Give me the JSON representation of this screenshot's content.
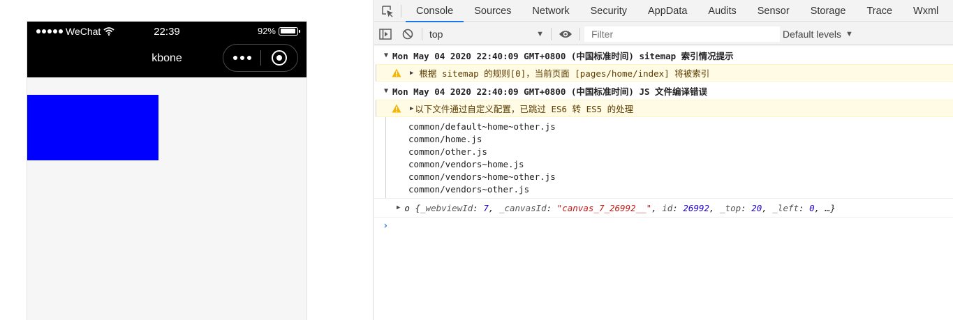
{
  "simulator": {
    "status_bar": {
      "carrier": "WeChat",
      "time": "22:39",
      "battery_percent": "92%",
      "battery_level": 0.92
    },
    "nav_bar": {
      "title": "kbone"
    },
    "content": {
      "box_color": "#0000ff"
    }
  },
  "devtools": {
    "tabs": [
      {
        "label": "Console",
        "active": true
      },
      {
        "label": "Sources"
      },
      {
        "label": "Network"
      },
      {
        "label": "Security"
      },
      {
        "label": "AppData"
      },
      {
        "label": "Audits"
      },
      {
        "label": "Sensor"
      },
      {
        "label": "Storage"
      },
      {
        "label": "Trace"
      },
      {
        "label": "Wxml"
      }
    ],
    "toolbar": {
      "context": "top",
      "filter_placeholder": "Filter",
      "levels": "Default levels"
    },
    "console": {
      "group1": {
        "header": "Mon May 04 2020 22:40:09 GMT+0800 (中国标准时间) sitemap 索引情况提示",
        "warning": "根据 sitemap 的规则[0]，当前页面 [pages/home/index] 将被索引"
      },
      "group2": {
        "header": "Mon May 04 2020 22:40:09 GMT+0800 (中国标准时间) JS 文件编译错误",
        "warning": "以下文件通过自定义配置，已跳过 ES6 转 ES5 的处理",
        "files": [
          "common/default~home~other.js",
          "common/home.js",
          "common/other.js",
          "common/vendors~home.js",
          "common/vendors~home~other.js",
          "common/vendors~other.js"
        ]
      },
      "object_log": {
        "name": "o",
        "open": "{",
        "k1": "_webviewId",
        "v1": "7",
        "k2": "_canvasId",
        "v2": "\"canvas_7_26992__\"",
        "k3": "id",
        "v3": "26992",
        "k4": "_top",
        "v4": "20",
        "k5": "_left",
        "v5": "0",
        "tail": "…}"
      }
    },
    "colors": {
      "active_tab_underline": "#1a73e8",
      "warning_bg": "#fffbe5",
      "warning_icon": "#f4b400"
    },
    "icons": [
      "inspect-icon",
      "sidebar-toggle-icon",
      "clear-console-icon",
      "eye-icon",
      "warning-icon",
      "prompt-chevron-icon"
    ]
  }
}
